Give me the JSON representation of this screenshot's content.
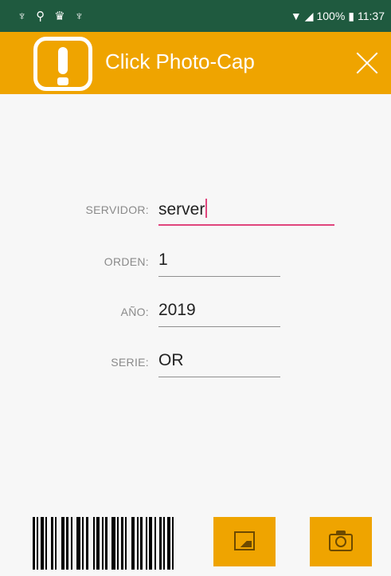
{
  "status_bar": {
    "icons_left": [
      "♆",
      "⚲",
      "♛",
      "♆"
    ],
    "battery": "100%",
    "time": "11:37"
  },
  "app_bar": {
    "title": "Click Photo-Cap",
    "logo": "exclamation-logo",
    "close_icon": "close-icon"
  },
  "form": {
    "fields": [
      {
        "label": "SERVIDOR:",
        "value": "server"
      },
      {
        "label": "ORDEN:",
        "value": "1"
      },
      {
        "label": "AÑO:",
        "value": "2019"
      },
      {
        "label": "SERIE:",
        "value": "OR"
      }
    ]
  },
  "bottom": {
    "barcode": "barcode-icon",
    "gallery_icon": "image-icon",
    "camera_icon": "camera-icon"
  },
  "colors": {
    "status_bar": "#1f5a3f",
    "accent": "#efa400",
    "focus_underline": "#e0457c"
  }
}
